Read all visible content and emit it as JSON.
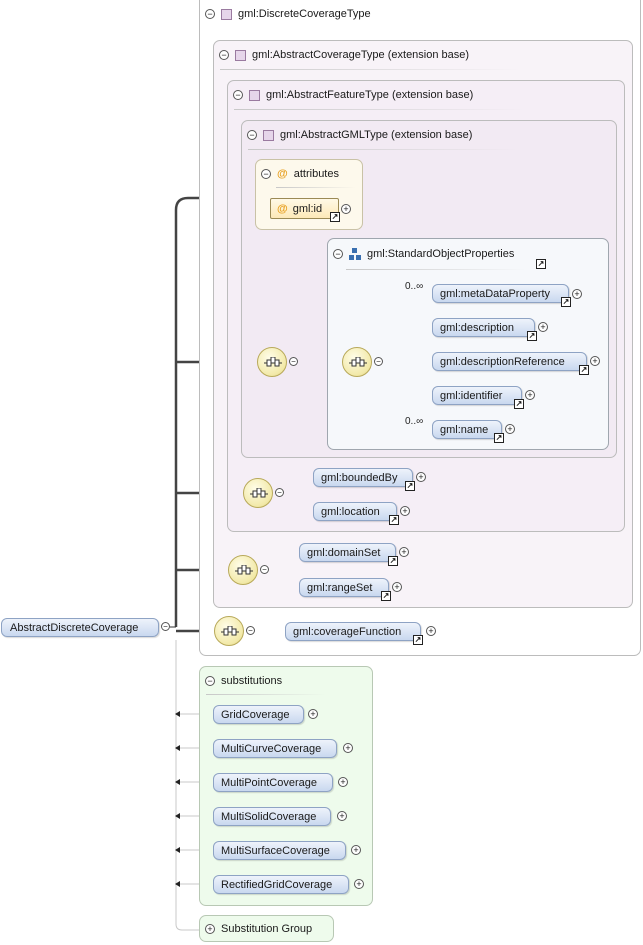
{
  "root": {
    "label": "AbstractDiscreteCoverage"
  },
  "discrete_coverage_type": {
    "label": "gml:DiscreteCoverageType"
  },
  "abstract_coverage_type": {
    "label": "gml:AbstractCoverageType (extension base)"
  },
  "abstract_feature_type": {
    "label": "gml:AbstractFeatureType (extension base)"
  },
  "abstract_gml_type": {
    "label": "gml:AbstractGMLType (extension base)"
  },
  "attributes": {
    "label": "attributes",
    "id_label": "gml:id"
  },
  "standard_object_properties": {
    "label": "gml:StandardObjectProperties",
    "items": [
      {
        "label": "gml:metaDataProperty",
        "occurs": "0..∞"
      },
      {
        "label": "gml:description",
        "occurs": ""
      },
      {
        "label": "gml:descriptionReference",
        "occurs": ""
      },
      {
        "label": "gml:identifier",
        "occurs": ""
      },
      {
        "label": "gml:name",
        "occurs": "0..∞"
      }
    ]
  },
  "feature_sequence": {
    "items": [
      "gml:boundedBy",
      "gml:location"
    ]
  },
  "coverage_sequence": {
    "items": [
      "gml:domainSet",
      "gml:rangeSet"
    ]
  },
  "discrete_sequence": {
    "items": [
      "gml:coverageFunction"
    ]
  },
  "substitutions": {
    "label": "substitutions",
    "items": [
      "GridCoverage",
      "MultiCurveCoverage",
      "MultiPointCoverage",
      "MultiSolidCoverage",
      "MultiSurfaceCoverage",
      "RectifiedGridCoverage"
    ]
  },
  "substitution_group": {
    "label": "Substitution Group"
  },
  "colors": {
    "element_fill": "#c9d8ef",
    "complex_type_bg": "#f7f3f8",
    "substitutions_bg": "#eefbec",
    "sequence_fill": "#f2e9a8"
  }
}
